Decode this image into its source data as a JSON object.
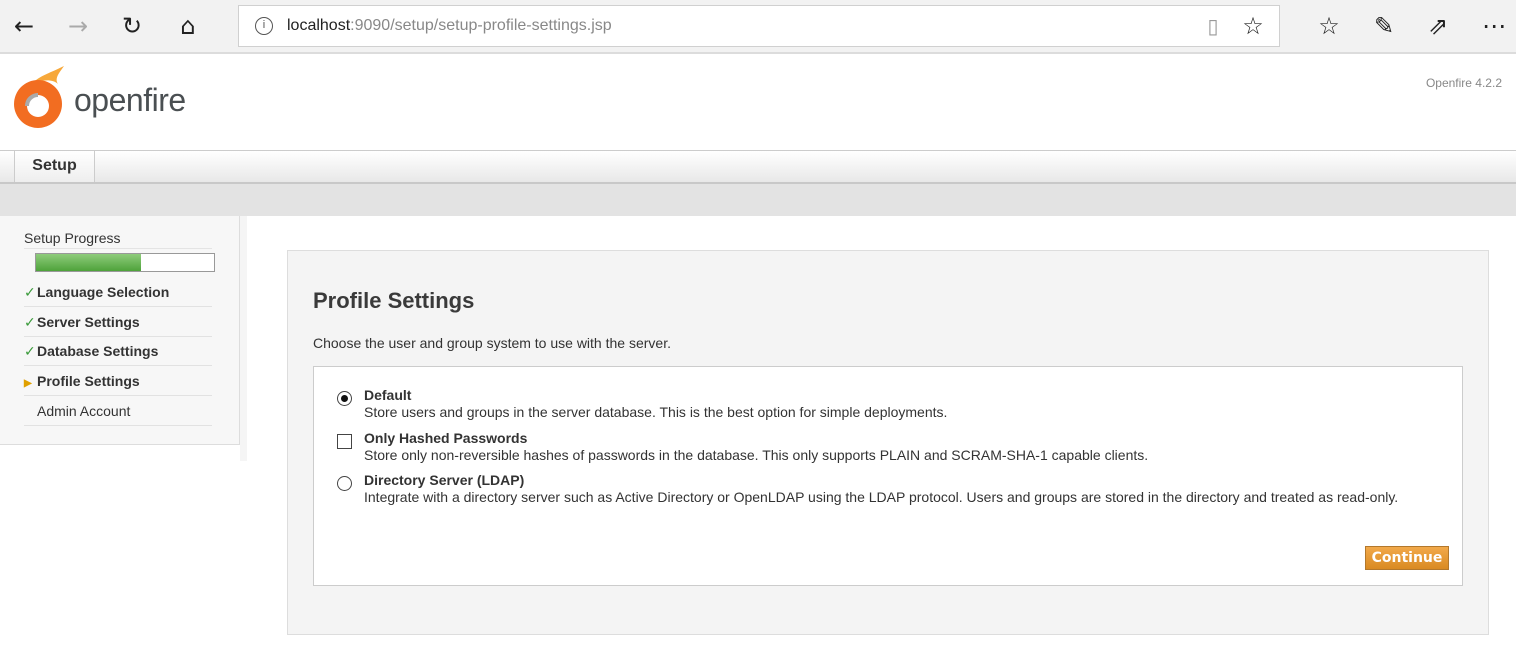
{
  "browser": {
    "url_host": "localhost",
    "url_rest": ":9090/setup/setup-profile-settings.jsp"
  },
  "header": {
    "logo_text": "openfire",
    "version": "Openfire 4.2.2"
  },
  "tabs": [
    {
      "label": "Setup"
    }
  ],
  "sidebar": {
    "title": "Setup Progress",
    "progress_percent": 59,
    "items": [
      {
        "label": "Language Selection",
        "state": "done"
      },
      {
        "label": "Server Settings",
        "state": "done"
      },
      {
        "label": "Database Settings",
        "state": "done"
      },
      {
        "label": "Profile Settings",
        "state": "current"
      },
      {
        "label": "Admin Account",
        "state": "pending"
      }
    ]
  },
  "main": {
    "title": "Profile Settings",
    "intro": "Choose the user and group system to use with the server.",
    "options": [
      {
        "label": "Default",
        "desc": "Store users and groups in the server database. This is the best option for simple deployments.",
        "type": "radio",
        "checked": true
      },
      {
        "label": "Only Hashed Passwords",
        "desc": "Store only non-reversible hashes of passwords in the database. This only supports PLAIN and SCRAM-SHA-1 capable clients.",
        "type": "checkbox",
        "checked": false
      },
      {
        "label": "Directory Server (LDAP)",
        "desc": "Integrate with a directory server such as Active Directory or OpenLDAP using the LDAP protocol. Users and groups are stored in the directory and treated as read-only.",
        "type": "radio",
        "checked": false
      }
    ],
    "continue_label": "Continue"
  },
  "colors": {
    "accent": "#e0922e",
    "progress": "#5aa845"
  }
}
